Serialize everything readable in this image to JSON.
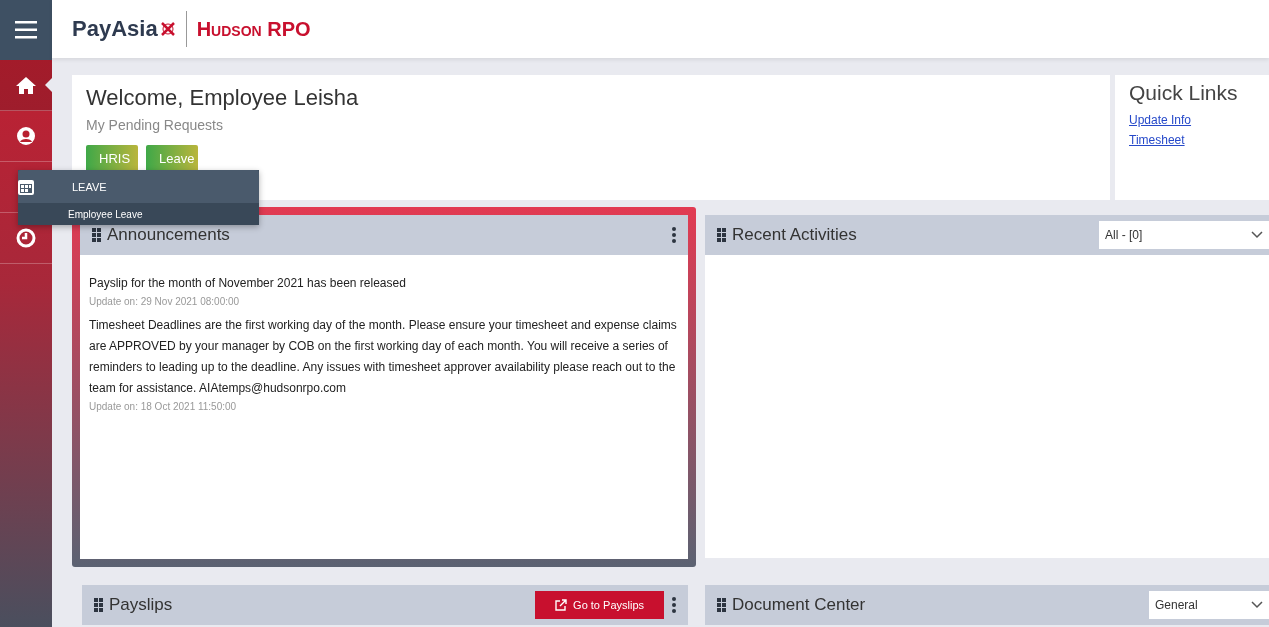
{
  "header": {
    "logo": "PayAsia",
    "company": "Hudson RPO"
  },
  "sidebar": {
    "items": [
      {
        "kind": "home",
        "selected": true
      },
      {
        "kind": "user",
        "selected": false
      },
      {
        "kind": "calendar",
        "selected": false
      },
      {
        "kind": "clock",
        "selected": false
      }
    ]
  },
  "flyout": {
    "title": "LEAVE",
    "items": [
      "Employee Leave"
    ]
  },
  "welcome": {
    "title": "Welcome, Employee Leisha",
    "subtitle": "My Pending Requests",
    "badges": [
      "HRIS",
      "Leave"
    ]
  },
  "quick_links": {
    "title": "Quick Links",
    "links": [
      "Update Info",
      "Timesheet"
    ]
  },
  "announcements": {
    "title": "Announcements",
    "items": [
      {
        "text": "Payslip for the month of November 2021 has been released",
        "date": "Update on: 29 Nov 2021 08:00:00"
      },
      {
        "text": "Timesheet Deadlines are the first working day of the month. Please ensure your timesheet and expense claims are APPROVED by your manager by COB on the first working day of each month. You will receive a series of reminders to leading up to the deadline. Any issues with timesheet approver availability please reach out to the team for assistance. AIAtemps@hudsonrpo.com",
        "date": "Update on: 18 Oct 2021 11:50:00"
      }
    ]
  },
  "recent_activities": {
    "title": "Recent Activities",
    "filter": "All - [0]"
  },
  "payslips": {
    "title": "Payslips",
    "button": "Go to Payslips"
  },
  "document_center": {
    "title": "Document Center",
    "filter": "General"
  }
}
